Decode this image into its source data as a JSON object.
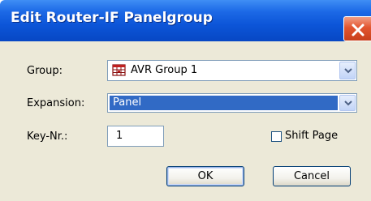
{
  "window": {
    "title": "Edit Router-IF Panelgroup",
    "close_icon": "close-x-icon"
  },
  "form": {
    "group": {
      "label": "Group:",
      "value": "AVR Group 1",
      "icon": "group-grid-icon"
    },
    "expansion": {
      "label": "Expansion:",
      "value": "Panel"
    },
    "key_nr": {
      "label": "Key-Nr.:",
      "value": "1"
    },
    "shift_page": {
      "label": "Shift Page",
      "checked": false
    }
  },
  "buttons": {
    "ok_label": "OK",
    "cancel_label": "Cancel"
  },
  "colors": {
    "titlebar": "#0c55d8",
    "dialog_face": "#ece9d8",
    "selection": "#316ac5",
    "close_button": "#e2552f"
  }
}
